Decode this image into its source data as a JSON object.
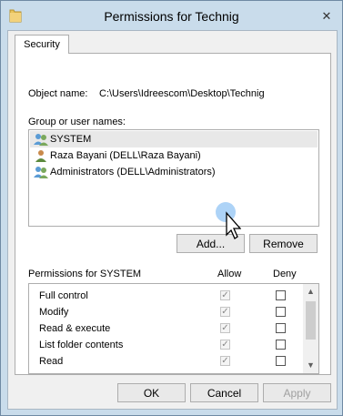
{
  "window": {
    "title": "Permissions for Technig",
    "close_glyph": "✕"
  },
  "tabs": [
    {
      "label": "Security"
    }
  ],
  "object": {
    "label": "Object name:",
    "value": "C:\\Users\\Idreescom\\Desktop\\Technig"
  },
  "groups": {
    "label": "Group or user names:",
    "items": [
      {
        "label": "SYSTEM",
        "selected": true,
        "icon": "users-group-icon"
      },
      {
        "label": "Raza Bayani (DELL\\Raza Bayani)",
        "selected": false,
        "icon": "user-icon"
      },
      {
        "label": "Administrators (DELL\\Administrators)",
        "selected": false,
        "icon": "users-group-icon"
      }
    ]
  },
  "buttons": {
    "add": "Add...",
    "remove": "Remove",
    "ok": "OK",
    "cancel": "Cancel",
    "apply": "Apply"
  },
  "permissions": {
    "label": "Permissions for SYSTEM",
    "allow_header": "Allow",
    "deny_header": "Deny",
    "rows": [
      {
        "label": "Full control",
        "allow": true,
        "deny": false
      },
      {
        "label": "Modify",
        "allow": true,
        "deny": false
      },
      {
        "label": "Read & execute",
        "allow": true,
        "deny": false
      },
      {
        "label": "List folder contents",
        "allow": true,
        "deny": false
      },
      {
        "label": "Read",
        "allow": true,
        "deny": false
      }
    ],
    "checkmark": "✓"
  },
  "scrollbar": {
    "up_glyph": "▲",
    "down_glyph": "▼"
  },
  "colors": {
    "title_bar": "#c9dceb",
    "selection": "#e8e8e8"
  }
}
